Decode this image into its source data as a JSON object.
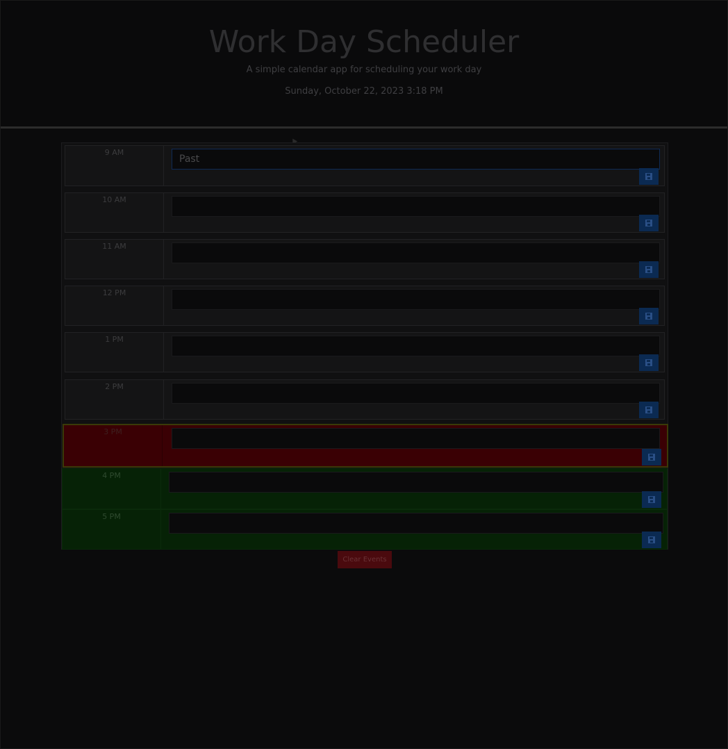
{
  "header": {
    "title": "Work Day Scheduler",
    "subtitle": "A simple calendar app for scheduling your work day",
    "date": "Sunday, October 22, 2023 3:18 PM"
  },
  "rows": [
    {
      "hour": "9 AM",
      "value": "Past",
      "state": "past"
    },
    {
      "hour": "10 AM",
      "value": "",
      "state": "past"
    },
    {
      "hour": "11 AM",
      "value": "",
      "state": "past"
    },
    {
      "hour": "12 PM",
      "value": "",
      "state": "past"
    },
    {
      "hour": "1 PM",
      "value": "",
      "state": "past"
    },
    {
      "hour": "2 PM",
      "value": "",
      "state": "past"
    },
    {
      "hour": "3 PM",
      "value": "",
      "state": "present"
    },
    {
      "hour": "4 PM",
      "value": "",
      "state": "future"
    },
    {
      "hour": "5 PM",
      "value": "",
      "state": "future"
    }
  ],
  "clear_button": "Clear Events",
  "icons": {
    "save": "save-icon"
  },
  "colors": {
    "past": "#141415",
    "present": "#3a0004",
    "future": "#062206",
    "save_button": "#0b2a52",
    "clear_button": "#4a0a0e"
  }
}
